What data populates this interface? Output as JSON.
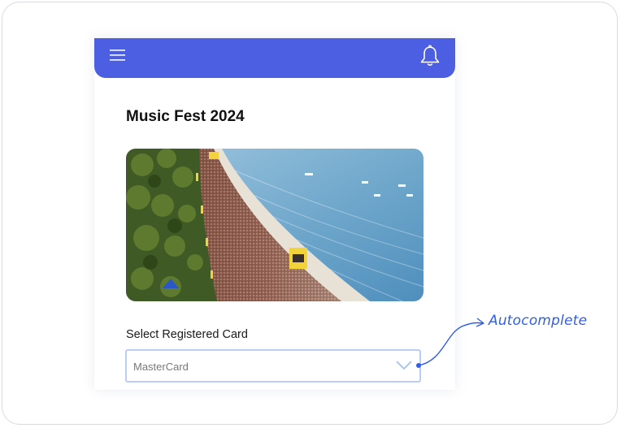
{
  "event": {
    "title": "Music Fest 2024"
  },
  "form": {
    "card_label": "Select Registered Card",
    "card_value": "MasterCard"
  },
  "annotation": {
    "label": "Autocomplete"
  },
  "icons": {
    "menu": "hamburger-menu-icon",
    "notifications": "bell-icon",
    "dropdown": "chevron-down-icon"
  },
  "colors": {
    "app_bar": "#4c5fe3",
    "select_border": "#b9cdf6",
    "annotation": "#2f5ee6"
  }
}
